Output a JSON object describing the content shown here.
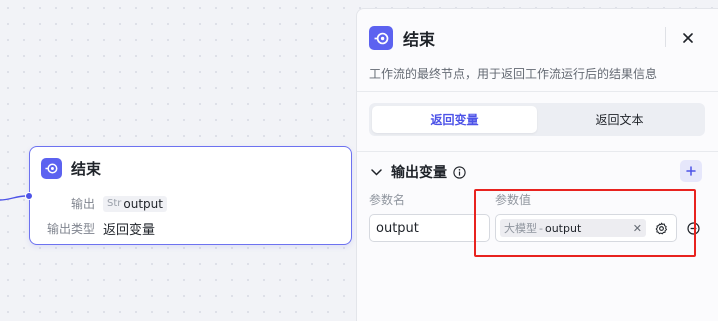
{
  "node": {
    "title": "结束",
    "output_key": "输出",
    "output_type": "Str",
    "output_value": "output",
    "output_type_key": "输出类型",
    "output_type_value": "返回变量"
  },
  "panel": {
    "title": "结束",
    "description": "工作流的最终节点，用于返回工作流运行后的结果信息",
    "tabs": [
      {
        "label": "返回变量",
        "active": true
      },
      {
        "label": "返回文本",
        "active": false
      }
    ],
    "section": {
      "title": "输出变量",
      "col_name": "参数名",
      "col_value": "参数值",
      "param_name": "output",
      "ref_source": "大模型",
      "ref_sep": "-",
      "ref_var": "output"
    }
  },
  "colors": {
    "accent": "#4d53e8",
    "highlight": "#e8231f"
  },
  "icons": [
    "end-node-icon",
    "close-icon",
    "chevron-down-icon",
    "info-icon",
    "plus-icon",
    "settings-gear-icon",
    "remove-circle-icon"
  ]
}
